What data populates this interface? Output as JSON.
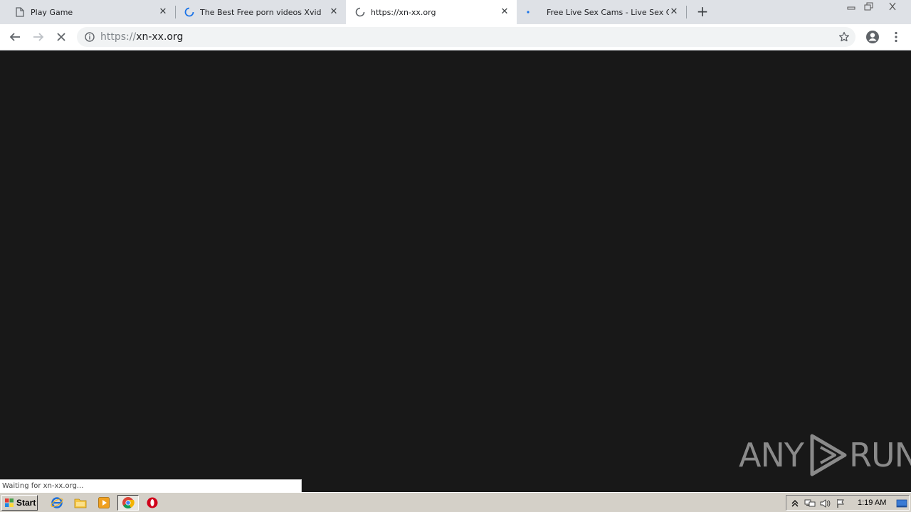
{
  "tabs": [
    {
      "title": "Play Game",
      "favicon": "page-icon",
      "active": false
    },
    {
      "title": "The Best Free porn videos Xvideos",
      "favicon": "loading-spinner-icon",
      "active": false
    },
    {
      "title": "https://xn-xx.org",
      "favicon": "loading-spinner-icon",
      "active": true
    },
    {
      "title": "Free Live Sex Cams - Live Sex Chat",
      "favicon": "dot-icon",
      "active": false
    }
  ],
  "toolbar": {
    "url_scheme": "https://",
    "url_host": "xn-xx.org"
  },
  "status_bar": {
    "text": "Waiting for xn-xx.org..."
  },
  "watermark": {
    "left": "ANY",
    "right": "RUN"
  },
  "taskbar": {
    "start_label": "Start",
    "clock": "1:19 AM"
  },
  "colors": {
    "content_bg": "#181818",
    "tabstrip_bg": "#dee1e6",
    "spinner_blue": "#1a73e8"
  }
}
